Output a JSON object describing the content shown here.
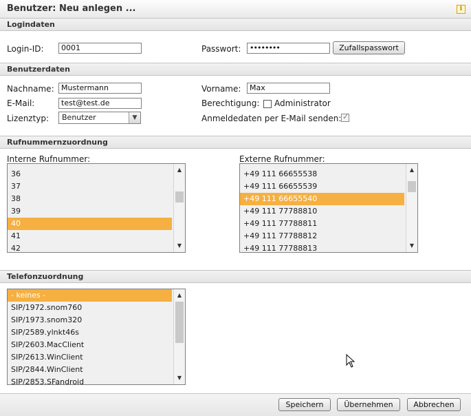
{
  "window": {
    "title": "Benutzer: Neu anlegen ..."
  },
  "sections": {
    "logindaten": "Logindaten",
    "benutzerdaten": "Benutzerdaten",
    "rufnummern": "Rufnummernzuordnung",
    "telefon": "Telefonzuordnung"
  },
  "login": {
    "login_id_label": "Login-ID:",
    "login_id_value": "0001",
    "password_label": "Passwort:",
    "password_value": "••••••••",
    "random_password_button": "Zufallspasswort"
  },
  "user": {
    "nachname_label": "Nachname:",
    "nachname_value": "Mustermann",
    "vorname_label": "Vorname:",
    "vorname_value": "Max",
    "email_label": "E-Mail:",
    "email_value": "test@test.de",
    "berechtigung_label": "Berechtigung:",
    "administrator_label": "Administrator",
    "administrator_checked": false,
    "lizenztyp_label": "Lizenztyp:",
    "lizenztyp_value": "Benutzer",
    "anmeldedaten_label": "Anmeldedaten per E-Mail senden:",
    "anmeldedaten_checked": true
  },
  "numbers": {
    "intern_label": "Interne Rufnummer:",
    "intern_items": [
      "36",
      "37",
      "38",
      "39",
      "40",
      "41",
      "42"
    ],
    "intern_selected": "40",
    "extern_label": "Externe Rufnummer:",
    "extern_items": [
      "+49 111 66655538",
      "+49 111 66655539",
      "+49 111 66655540",
      "+49 111 77788810",
      "+49 111 77788811",
      "+49 111 77788812",
      "+49 111 77788813"
    ],
    "extern_selected": "+49 111 66655540"
  },
  "phones": {
    "items": [
      "- keines -",
      "SIP/1972.snom760",
      "SIP/1973.snom320",
      "SIP/2589.ylnkt46s",
      "SIP/2603.MacClient",
      "SIP/2613.WinClient",
      "SIP/2844.WinClient",
      "SIP/2853.SFandroid"
    ],
    "selected": "- keines -"
  },
  "footer": {
    "save_label": "Speichern",
    "apply_label": "Übernehmen",
    "cancel_label": "Abbrechen"
  },
  "icons": {
    "info": "info-icon",
    "scroll_up": "chevron-up-icon",
    "scroll_down": "chevron-down-icon",
    "cursor": "mouse-pointer-icon"
  },
  "colors": {
    "selection": "#f5b041",
    "section_bg": "#e8e8e8"
  }
}
